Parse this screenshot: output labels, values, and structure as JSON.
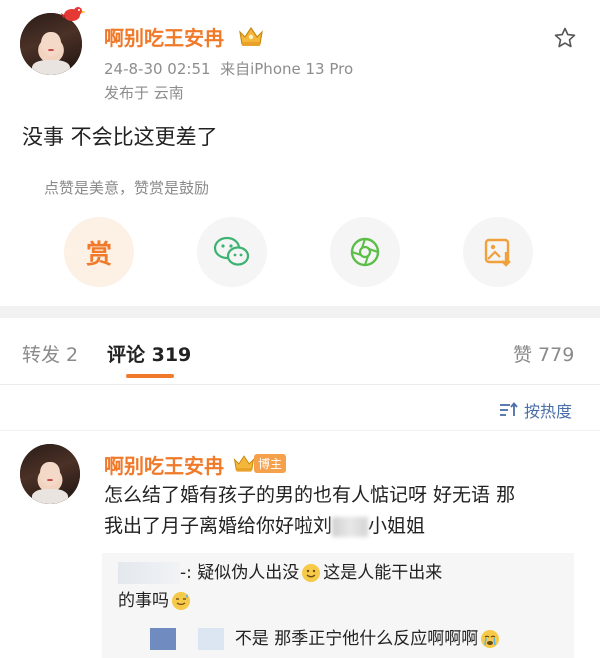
{
  "post": {
    "author": "啊别吃王安冉",
    "time": "24-8-30 02:51",
    "source": "来自iPhone 13 Pro",
    "location": "发布于 云南",
    "content": "没事 不会比这更差了",
    "reward_hint": "点赞是美意，赞赏是鼓励",
    "reward_label": "赏"
  },
  "tabs": {
    "repost": "转发 2",
    "comments": "评论 319",
    "likes": "赞 779"
  },
  "sort": {
    "label": "按热度"
  },
  "comment": {
    "author": "啊别吃王安冉",
    "badge": "博主",
    "text_line1": "怎么结了婚有孩子的男的也有人惦记呀 好无语 那",
    "text_line2a": "我出了月子离婚给你好啦刘",
    "text_line2b": "小姐姐",
    "reply1_prefix": "-: 疑似伪人出没",
    "reply1_mid": "这是人能干出来",
    "reply1_line2": "的事吗",
    "reply2": "不是 那季正宁他什么反应啊啊啊"
  },
  "colors": {
    "brand_orange": "#f07a2a",
    "wechat_green": "#3cb371",
    "moments_green": "#5bbf47",
    "save_orange": "#f0a13c"
  },
  "icons": [
    "bird-icon",
    "crown-badge-icon",
    "star-icon",
    "reward-icon",
    "wechat-icon",
    "moments-icon",
    "save-image-icon",
    "sort-icon",
    "smile-emoji-icon",
    "sweat-emoji-icon",
    "cry-emoji-icon"
  ]
}
